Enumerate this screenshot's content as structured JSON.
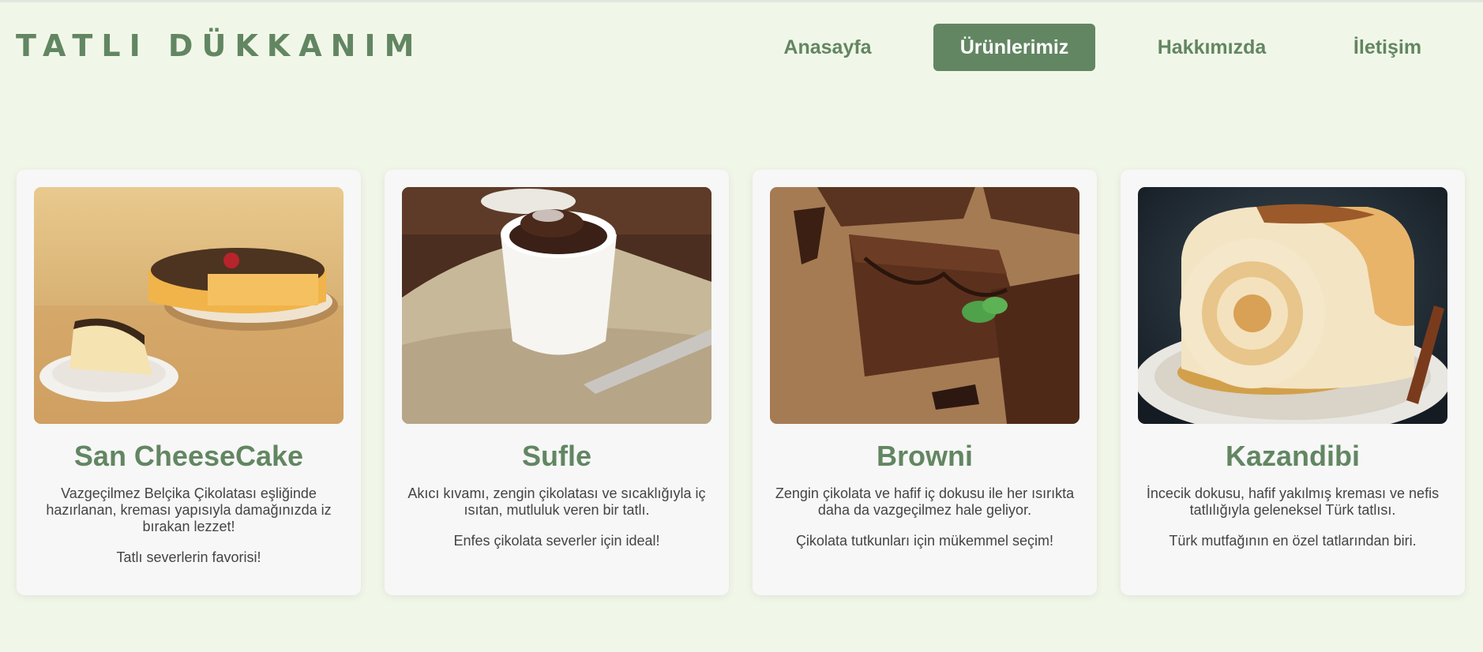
{
  "brand": {
    "logo_text": "TATLI DÜKKANIM"
  },
  "nav": {
    "items": [
      {
        "label": "Anasayfa",
        "active": false
      },
      {
        "label": "Ürünlerimiz",
        "active": true
      },
      {
        "label": "Hakkımızda",
        "active": false
      },
      {
        "label": "İletişim",
        "active": false
      }
    ]
  },
  "colors": {
    "accent": "#628662",
    "background": "#f1f7e8",
    "card": "#f7f7f7"
  },
  "products": [
    {
      "title": "San CheeseCake",
      "description": "Vazgeçilmez Belçika Çikolatası eşliğinde hazırlanan, kreması yapısıyla damağınızda iz bırakan lezzet!",
      "note": "Tatlı severlerin favorisi!",
      "image_icon": "cheesecake-image"
    },
    {
      "title": "Sufle",
      "description": "Akıcı kıvamı, zengin çikolatası ve sıcaklığıyla iç ısıtan, mutluluk veren bir tatlı.",
      "note": "Enfes çikolata severler için ideal!",
      "image_icon": "souffle-image"
    },
    {
      "title": "Browni",
      "description": "Zengin çikolata ve hafif iç dokusu ile her ısırıkta daha da vazgeçilmez hale geliyor.",
      "note": "Çikolata tutkunları için mükemmel seçim!",
      "image_icon": "brownie-image"
    },
    {
      "title": "Kazandibi",
      "description": "İncecik dokusu, hafif yakılmış kreması ve nefis tatlılığıyla geleneksel Türk tatlısı.",
      "note": "Türk mutfağının en özel tatlarından biri.",
      "image_icon": "kazandibi-image"
    }
  ]
}
